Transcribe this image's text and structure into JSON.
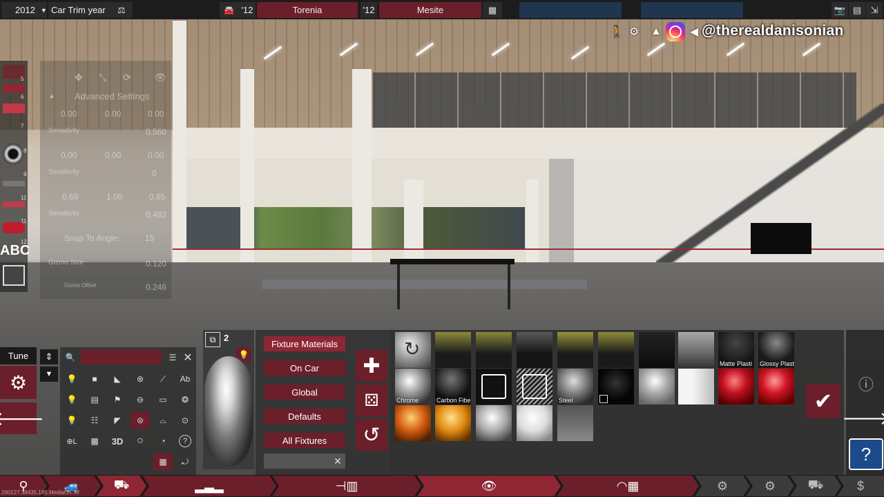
{
  "topbar": {
    "year": "2012",
    "year_caret": "▼",
    "car_trim_label": "Car Trim year",
    "model_year_short": "'12",
    "model_name": "Torenia",
    "trim_year_short": "'12",
    "trim_name": "Mesite"
  },
  "overlay": {
    "social_handle": "@therealdanisonian"
  },
  "left_strip": {
    "numbers": [
      "5",
      "6",
      "7",
      "8",
      "9",
      "11",
      "11",
      "12"
    ],
    "text_badge": "ABC"
  },
  "advanced_settings": {
    "title": "Advanced Settings",
    "row1": [
      "0.00",
      "0.00",
      "0.00"
    ],
    "sensitivity1": "0.560",
    "row2": [
      "0.00",
      "0.00",
      "0.00"
    ],
    "sensitivity2": "0",
    "row3": [
      "0.69",
      "1.00",
      "0.85"
    ],
    "sensitivity3": "0.482",
    "sensitivity_label": "Sensitivity",
    "snap_label": "Snap To Angle:",
    "snap_value": "15",
    "gizmo_size_label": "Gizmo Size",
    "gizmo_size_value": "0.120",
    "gizmo_offset_label": "Gizmo Offset",
    "gizmo_offset_value": "0.246"
  },
  "tools": {
    "tune_label": "Tune",
    "search_value": "",
    "ab_label": "Ab",
    "three_d_label": "3D",
    "help_glyph": "?"
  },
  "preview": {
    "layer_count": "2"
  },
  "material_menu": {
    "buttons": [
      "Fixture Materials",
      "On Car",
      "Global",
      "Defaults",
      "All Fixtures"
    ],
    "search_value": ""
  },
  "materials": {
    "labels": {
      "matte_plastic": "Matte Plasti",
      "glossy_plastic": "Glossy Plast",
      "chrome": "Chrome",
      "carbon_fiber": "Carbon Fiber",
      "steel": "Steel"
    }
  },
  "bottom": {
    "build_string": "260127.38435.185.MediaCh..W"
  },
  "colors": {
    "accent": "#6b1f2a",
    "accent_active": "#8e2634",
    "help_blue": "#1c4a8a",
    "bar_blue": "#1f3550"
  }
}
